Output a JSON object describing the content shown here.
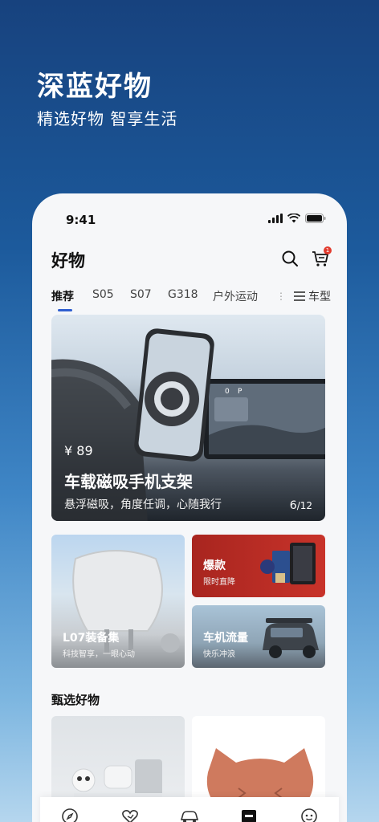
{
  "promo": {
    "title": "深蓝好物",
    "subtitle": "精选好物 智享生活"
  },
  "status_bar": {
    "time": "9:41"
  },
  "header": {
    "title": "好物"
  },
  "cart": {
    "badge": "1"
  },
  "tabs": [
    {
      "label": "推荐",
      "active": true
    },
    {
      "label": "S05"
    },
    {
      "label": "S07"
    },
    {
      "label": "G318"
    },
    {
      "label": "户外运动"
    }
  ],
  "tab_more": {
    "label": "车型"
  },
  "hero": {
    "price": "¥ 89",
    "name": "车载磁吸手机支架",
    "desc": "悬浮磁吸，角度任调，心随我行",
    "pager_current": "6",
    "pager_total": "/12",
    "screen_gear": "P",
    "screen_speed": "0"
  },
  "cards": {
    "l07": {
      "title": "L07装备集",
      "subtitle": "科技智享，一眼心动"
    },
    "hot": {
      "title": "爆款",
      "subtitle": "限时直降"
    },
    "flow": {
      "title": "车机流量",
      "subtitle": "快乐冲浪"
    }
  },
  "section": {
    "title": "甄选好物"
  },
  "colors": {
    "accent": "#2f5fd0",
    "badge": "#e23b2e",
    "hot_bg": "#c8332a"
  },
  "nav_icons": [
    "discover-icon",
    "heart-hand-icon",
    "car-icon",
    "store-icon",
    "profile-icon"
  ]
}
